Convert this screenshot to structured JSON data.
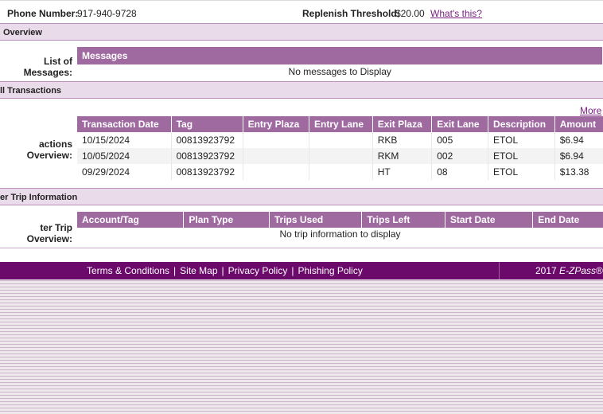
{
  "header": {
    "phone_label": "Phone Number:",
    "phone_value": "917-940-9728",
    "threshold_label": "Replenish Threshold:",
    "threshold_value": "$20.00",
    "whats_this": "What's this?"
  },
  "overview": {
    "title": "Overview",
    "messages_label": "List of Messages:",
    "messages_header": "Messages",
    "messages_empty": "No messages to Display"
  },
  "transactions": {
    "title": "ll Transactions",
    "more_link": "More",
    "overview_label": "actions Overview:",
    "columns": [
      "Transaction Date",
      "Tag",
      "Entry Plaza",
      "Entry Lane",
      "Exit Plaza",
      "Exit Lane",
      "Description",
      "Amount"
    ],
    "rows": [
      [
        "10/15/2024",
        "00813923792",
        "",
        "",
        "RKB",
        "005",
        "ETOL",
        "$6.94"
      ],
      [
        "10/05/2024",
        "00813923792",
        "",
        "",
        "RKM",
        "002",
        "ETOL",
        "$6.94"
      ],
      [
        "09/29/2024",
        "00813923792",
        "",
        "",
        "HT",
        "08",
        "ETOL",
        "$13.38"
      ]
    ]
  },
  "trips": {
    "title": "er Trip Information",
    "overview_label": "ter Trip Overview:",
    "columns": [
      "Account/Tag",
      "Plan Type",
      "Trips Used",
      "Trips Left",
      "Start Date",
      "End Date"
    ],
    "empty": "No trip information to display"
  },
  "footer": {
    "links": [
      "Terms & Conditions",
      "Site Map",
      "Privacy Policy",
      "Phishing Policy"
    ],
    "divider": "|",
    "copyright_prefix": "2017 ",
    "copyright_brand": "E-ZPass",
    "copyright_suffix": "® N"
  },
  "colors": {
    "header_purple": "#9e6aa0",
    "band_bg": "#eadbea",
    "footer_bg": "#6b0a6b",
    "link_purple": "#7a2282"
  }
}
